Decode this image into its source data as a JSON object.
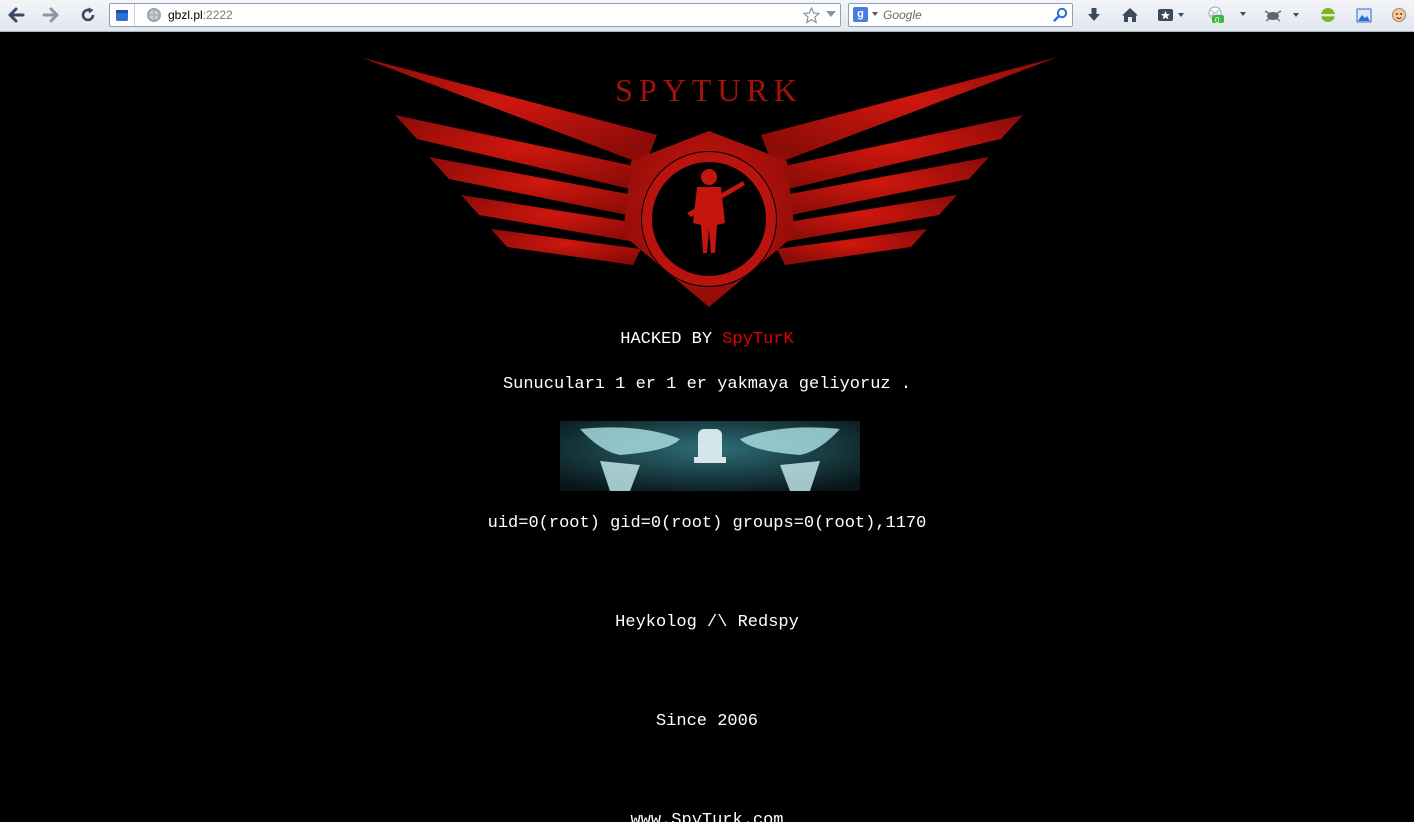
{
  "browser": {
    "url_host": "gbzl.pl",
    "url_port": ":2222",
    "search_placeholder": "Google",
    "search_engine_letter": "g",
    "badge_count": "0"
  },
  "page": {
    "hacked_prefix": "HACKED BY ",
    "hacked_name": "SpyTurK",
    "logo_text": "SPYTURK",
    "slogan": "Sunucuları 1 er 1 er yakmaya geliyoruz .",
    "uid_line": "uid=0(root) gid=0(root) groups=0(root),1170",
    "authors": "Heykolog /\\ Redspy",
    "since": "Since 2006",
    "site_url": "www.SpyTurk.com"
  },
  "colors": {
    "background": "#000000",
    "text": "#ffffff",
    "accent_red": "#e60000",
    "logo_red": "#b8130f"
  },
  "icons": [
    "back-icon",
    "forward-icon",
    "reload-icon",
    "site-identity-icon",
    "globe-icon",
    "star-icon",
    "dropdown-icon",
    "search-icon",
    "download-icon",
    "home-icon",
    "bookmarks-icon",
    "addon-icon",
    "bug-icon",
    "green-circle-icon",
    "image-icon",
    "face-icon"
  ]
}
